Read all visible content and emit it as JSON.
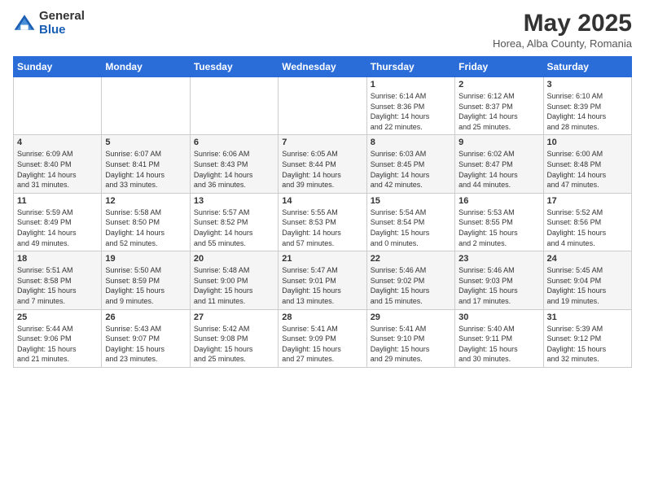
{
  "logo": {
    "general": "General",
    "blue": "Blue"
  },
  "title": "May 2025",
  "subtitle": "Horea, Alba County, Romania",
  "days_header": [
    "Sunday",
    "Monday",
    "Tuesday",
    "Wednesday",
    "Thursday",
    "Friday",
    "Saturday"
  ],
  "weeks": [
    [
      {
        "day": "",
        "info": ""
      },
      {
        "day": "",
        "info": ""
      },
      {
        "day": "",
        "info": ""
      },
      {
        "day": "",
        "info": ""
      },
      {
        "day": "1",
        "info": "Sunrise: 6:14 AM\nSunset: 8:36 PM\nDaylight: 14 hours\nand 22 minutes."
      },
      {
        "day": "2",
        "info": "Sunrise: 6:12 AM\nSunset: 8:37 PM\nDaylight: 14 hours\nand 25 minutes."
      },
      {
        "day": "3",
        "info": "Sunrise: 6:10 AM\nSunset: 8:39 PM\nDaylight: 14 hours\nand 28 minutes."
      }
    ],
    [
      {
        "day": "4",
        "info": "Sunrise: 6:09 AM\nSunset: 8:40 PM\nDaylight: 14 hours\nand 31 minutes."
      },
      {
        "day": "5",
        "info": "Sunrise: 6:07 AM\nSunset: 8:41 PM\nDaylight: 14 hours\nand 33 minutes."
      },
      {
        "day": "6",
        "info": "Sunrise: 6:06 AM\nSunset: 8:43 PM\nDaylight: 14 hours\nand 36 minutes."
      },
      {
        "day": "7",
        "info": "Sunrise: 6:05 AM\nSunset: 8:44 PM\nDaylight: 14 hours\nand 39 minutes."
      },
      {
        "day": "8",
        "info": "Sunrise: 6:03 AM\nSunset: 8:45 PM\nDaylight: 14 hours\nand 42 minutes."
      },
      {
        "day": "9",
        "info": "Sunrise: 6:02 AM\nSunset: 8:47 PM\nDaylight: 14 hours\nand 44 minutes."
      },
      {
        "day": "10",
        "info": "Sunrise: 6:00 AM\nSunset: 8:48 PM\nDaylight: 14 hours\nand 47 minutes."
      }
    ],
    [
      {
        "day": "11",
        "info": "Sunrise: 5:59 AM\nSunset: 8:49 PM\nDaylight: 14 hours\nand 49 minutes."
      },
      {
        "day": "12",
        "info": "Sunrise: 5:58 AM\nSunset: 8:50 PM\nDaylight: 14 hours\nand 52 minutes."
      },
      {
        "day": "13",
        "info": "Sunrise: 5:57 AM\nSunset: 8:52 PM\nDaylight: 14 hours\nand 55 minutes."
      },
      {
        "day": "14",
        "info": "Sunrise: 5:55 AM\nSunset: 8:53 PM\nDaylight: 14 hours\nand 57 minutes."
      },
      {
        "day": "15",
        "info": "Sunrise: 5:54 AM\nSunset: 8:54 PM\nDaylight: 15 hours\nand 0 minutes."
      },
      {
        "day": "16",
        "info": "Sunrise: 5:53 AM\nSunset: 8:55 PM\nDaylight: 15 hours\nand 2 minutes."
      },
      {
        "day": "17",
        "info": "Sunrise: 5:52 AM\nSunset: 8:56 PM\nDaylight: 15 hours\nand 4 minutes."
      }
    ],
    [
      {
        "day": "18",
        "info": "Sunrise: 5:51 AM\nSunset: 8:58 PM\nDaylight: 15 hours\nand 7 minutes."
      },
      {
        "day": "19",
        "info": "Sunrise: 5:50 AM\nSunset: 8:59 PM\nDaylight: 15 hours\nand 9 minutes."
      },
      {
        "day": "20",
        "info": "Sunrise: 5:48 AM\nSunset: 9:00 PM\nDaylight: 15 hours\nand 11 minutes."
      },
      {
        "day": "21",
        "info": "Sunrise: 5:47 AM\nSunset: 9:01 PM\nDaylight: 15 hours\nand 13 minutes."
      },
      {
        "day": "22",
        "info": "Sunrise: 5:46 AM\nSunset: 9:02 PM\nDaylight: 15 hours\nand 15 minutes."
      },
      {
        "day": "23",
        "info": "Sunrise: 5:46 AM\nSunset: 9:03 PM\nDaylight: 15 hours\nand 17 minutes."
      },
      {
        "day": "24",
        "info": "Sunrise: 5:45 AM\nSunset: 9:04 PM\nDaylight: 15 hours\nand 19 minutes."
      }
    ],
    [
      {
        "day": "25",
        "info": "Sunrise: 5:44 AM\nSunset: 9:06 PM\nDaylight: 15 hours\nand 21 minutes."
      },
      {
        "day": "26",
        "info": "Sunrise: 5:43 AM\nSunset: 9:07 PM\nDaylight: 15 hours\nand 23 minutes."
      },
      {
        "day": "27",
        "info": "Sunrise: 5:42 AM\nSunset: 9:08 PM\nDaylight: 15 hours\nand 25 minutes."
      },
      {
        "day": "28",
        "info": "Sunrise: 5:41 AM\nSunset: 9:09 PM\nDaylight: 15 hours\nand 27 minutes."
      },
      {
        "day": "29",
        "info": "Sunrise: 5:41 AM\nSunset: 9:10 PM\nDaylight: 15 hours\nand 29 minutes."
      },
      {
        "day": "30",
        "info": "Sunrise: 5:40 AM\nSunset: 9:11 PM\nDaylight: 15 hours\nand 30 minutes."
      },
      {
        "day": "31",
        "info": "Sunrise: 5:39 AM\nSunset: 9:12 PM\nDaylight: 15 hours\nand 32 minutes."
      }
    ]
  ]
}
